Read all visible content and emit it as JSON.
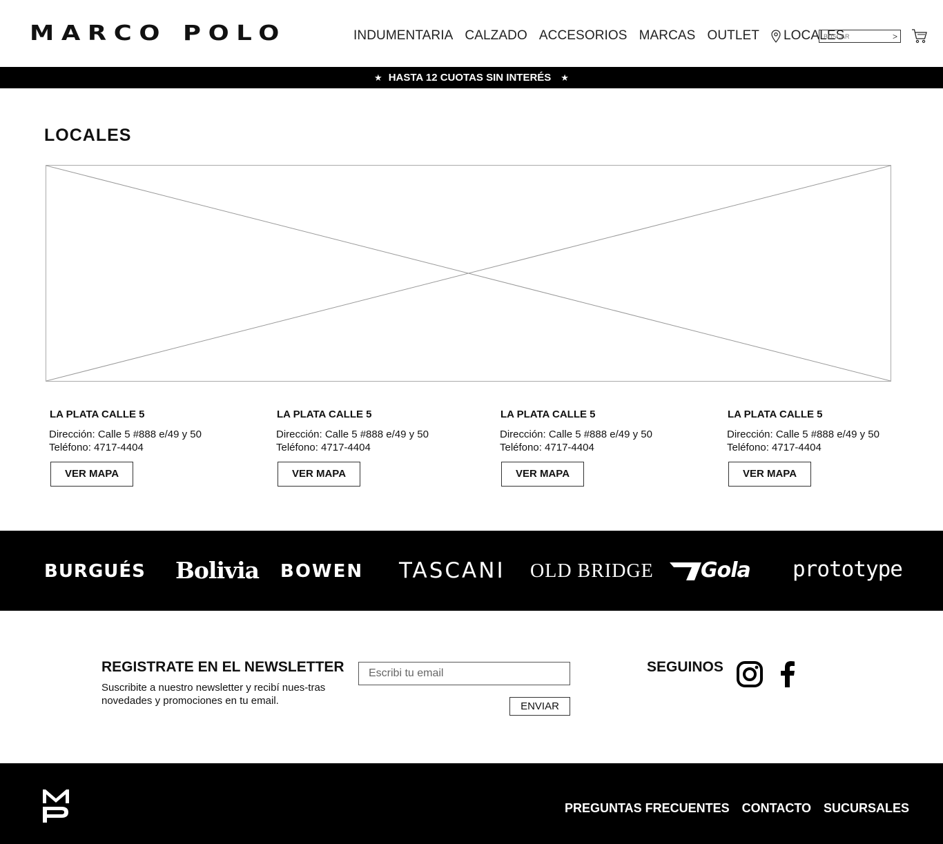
{
  "header": {
    "logo": "MARCO POLO",
    "nav": [
      "INDUMENTARIA",
      "CALZADO",
      "ACCESORIOS",
      "MARCAS",
      "OUTLET"
    ],
    "locales_label": "LOCALES",
    "search_placeholder": "BUSCAR",
    "search_go": ">"
  },
  "banner": {
    "text": "HASTA 12 CUOTAS SIN INTERÉS",
    "star": "★"
  },
  "main": {
    "title": "LOCALES",
    "stores": [
      {
        "name": "LA PLATA CALLE 5",
        "address": "Dirección: Calle 5 #888 e/49 y 50",
        "phone": "Teléfono: 4717-4404",
        "button": "VER MAPA"
      },
      {
        "name": "LA PLATA CALLE 5",
        "address": "Dirección: Calle 5 #888 e/49 y 50",
        "phone": "Teléfono: 4717-4404",
        "button": "VER MAPA"
      },
      {
        "name": "LA PLATA CALLE 5",
        "address": "Dirección: Calle 5 #888 e/49 y 50",
        "phone": "Teléfono: 4717-4404",
        "button": "VER MAPA"
      },
      {
        "name": "LA PLATA CALLE 5",
        "address": "Dirección: Calle 5 #888 e/49 y 50",
        "phone": "Teléfono: 4717-4404",
        "button": "VER MAPA"
      }
    ]
  },
  "brands": [
    "BURGUÉS",
    "Bolivia",
    "BOWEN",
    "TASCANI",
    "OLD BRIDGE",
    "Gola",
    "prototype"
  ],
  "newsletter": {
    "title": "REGISTRATE EN EL NEWSLETTER",
    "description": "Suscribite a nuestro newsletter y recibí nues-tras novedades y promociones en tu email.",
    "email_placeholder": "Escribi tu email",
    "send_label": "ENVIAR"
  },
  "social": {
    "title": "SEGUINOS",
    "icons": [
      "instagram-icon",
      "facebook-icon"
    ]
  },
  "footer": {
    "logo": "MP",
    "links": [
      "PREGUNTAS FRECUENTES",
      "CONTACTO",
      "SUCURSALES"
    ]
  }
}
